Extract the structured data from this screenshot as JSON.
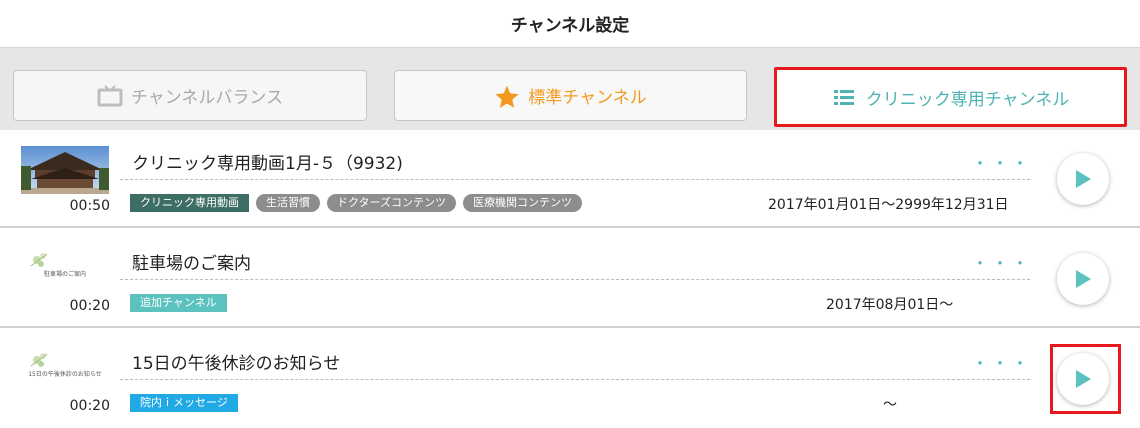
{
  "header": {
    "title": "チャンネル設定"
  },
  "tabs": [
    {
      "label": "チャンネルバランス",
      "icon": "tv-icon",
      "color": "#a9a9a9"
    },
    {
      "label": "標準チャンネル",
      "icon": "star-icon",
      "color": "#f39a1e"
    },
    {
      "label": "クリニック専用チャンネル",
      "icon": "list-icon",
      "color": "#4fb3b3",
      "selected": true
    }
  ],
  "rows": [
    {
      "title": "クリニック専用動画1月-５（9932)",
      "duration": "00:50",
      "thumb_caption": "",
      "date": "2017年01月01日〜2999年12月31日",
      "more": "・・・",
      "tags": [
        {
          "label": "クリニック専用動画",
          "color": "#3d6e66"
        },
        {
          "label": "生活習慣",
          "color": "#8d8d8d"
        },
        {
          "label": "ドクターズコンテンツ",
          "color": "#8d8d8d"
        },
        {
          "label": "医療機関コンテンツ",
          "color": "#8d8d8d"
        }
      ]
    },
    {
      "title": "駐車場のご案内",
      "duration": "00:20",
      "thumb_caption": "駐車場のご案内",
      "date": "2017年08月01日〜",
      "more": "・・・",
      "tags": [
        {
          "label": "追加チャンネル",
          "color": "#5cc2bf"
        }
      ]
    },
    {
      "title": "15日の午後休診のお知らせ",
      "duration": "00:20",
      "thumb_caption": "15日の午後休診のお知らせ",
      "date": "〜",
      "more": "・・・",
      "tags": [
        {
          "label": "院内ｉメッセージ",
          "color": "#21a9e6"
        }
      ]
    }
  ]
}
